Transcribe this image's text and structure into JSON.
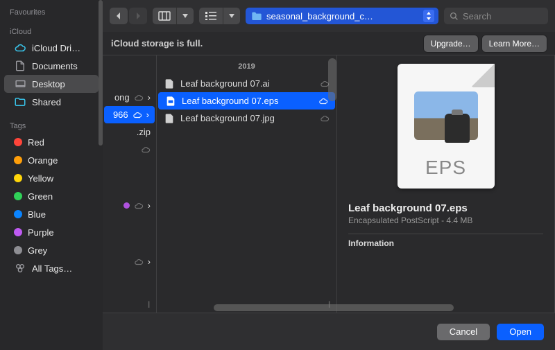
{
  "sidebar": {
    "sections": [
      {
        "label": "Favourites",
        "items": []
      },
      {
        "label": "iCloud",
        "items": [
          {
            "id": "icloud-drive",
            "label": "iCloud Dri…",
            "icon": "cloud",
            "color": "#39c4ea"
          },
          {
            "id": "documents",
            "label": "Documents",
            "icon": "doc",
            "color": "#a0a0a5"
          },
          {
            "id": "desktop",
            "label": "Desktop",
            "icon": "desktop",
            "color": "#a0a0a5",
            "selected": true
          },
          {
            "id": "shared",
            "label": "Shared",
            "icon": "folder-person",
            "color": "#39c4ea"
          }
        ]
      },
      {
        "label": "Tags",
        "items": [
          {
            "id": "tag-red",
            "label": "Red",
            "dot": "#ff453a"
          },
          {
            "id": "tag-orange",
            "label": "Orange",
            "dot": "#ff9f0a"
          },
          {
            "id": "tag-yellow",
            "label": "Yellow",
            "dot": "#ffd60a"
          },
          {
            "id": "tag-green",
            "label": "Green",
            "dot": "#30d158"
          },
          {
            "id": "tag-blue",
            "label": "Blue",
            "dot": "#0a84ff"
          },
          {
            "id": "tag-purple",
            "label": "Purple",
            "dot": "#bf5af2"
          },
          {
            "id": "tag-grey",
            "label": "Grey",
            "dot": "#8e8e93"
          },
          {
            "id": "tag-all",
            "label": "All Tags…",
            "icon": "alltags"
          }
        ]
      }
    ]
  },
  "toolbar": {
    "path_label": "seasonal_background_c…",
    "search_placeholder": "Search"
  },
  "notice": {
    "message": "iCloud storage is full.",
    "upgrade": "Upgrade…",
    "learn": "Learn More…"
  },
  "column0": {
    "rows": [
      {
        "label": "ong",
        "cloud": true,
        "chevron": true
      },
      {
        "label": "966",
        "cloud": true,
        "chevron": true,
        "selected": true
      },
      {
        "label": ".zip",
        "cloud": false
      },
      {
        "label": "",
        "cloud": true
      },
      {
        "label": "",
        "purple": true,
        "cloud": true,
        "chevron": true
      },
      {
        "label": "",
        "cloud": true,
        "chevron": true
      }
    ]
  },
  "column1": {
    "header": "2019",
    "rows": [
      {
        "name": "Leaf background 07.ai",
        "cloud": true
      },
      {
        "name": "Leaf background 07.eps",
        "cloud": true,
        "selected": true
      },
      {
        "name": "Leaf background 07.jpg",
        "cloud": true
      }
    ]
  },
  "preview": {
    "badge": "EPS",
    "title": "Leaf background 07.eps",
    "subtitle": "Encapsulated PostScript - 4.4 MB",
    "info_header": "Information"
  },
  "footer": {
    "cancel": "Cancel",
    "open": "Open"
  }
}
